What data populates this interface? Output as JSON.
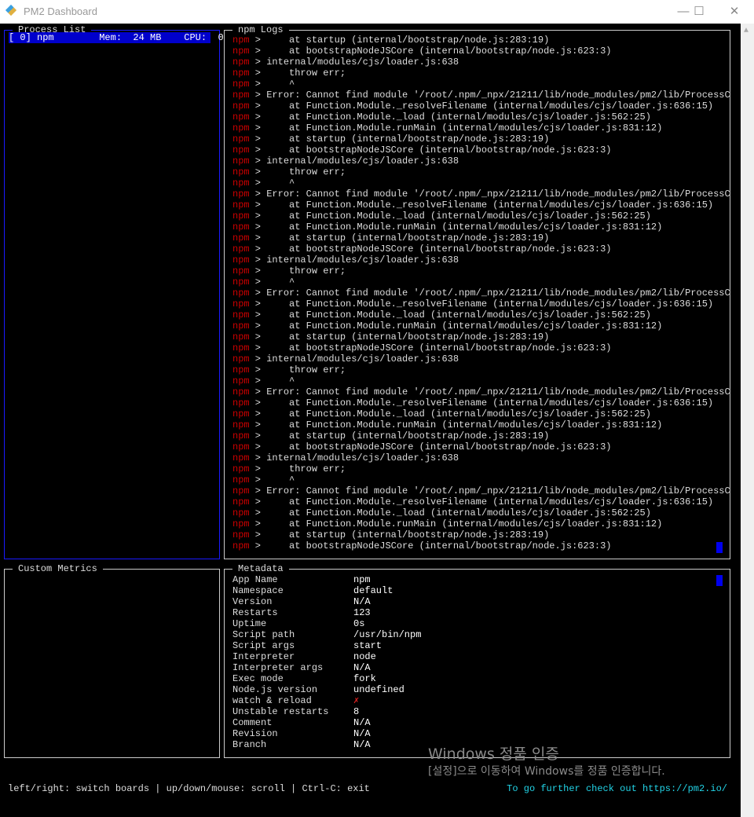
{
  "window": {
    "title": "PM2 Dashboard",
    "minimize": "—",
    "maximize": "☐",
    "close": "✕"
  },
  "process_list": {
    "title": "Process List",
    "items": [
      {
        "label": "[ 0] npm        Mem:  24 MB    CPU:  0"
      }
    ]
  },
  "logs": {
    "title": "npm Logs",
    "prefix": "npm",
    "lines": [
      "     at startup (internal/bootstrap/node.js:283:19)",
      "     at bootstrapNodeJSCore (internal/bootstrap/node.js:623:3)",
      " internal/modules/cjs/loader.js:638",
      "     throw err;",
      "     ^",
      " Error: Cannot find module '/root/.npm/_npx/21211/lib/node_modules/pm2/lib/ProcessC",
      "     at Function.Module._resolveFilename (internal/modules/cjs/loader.js:636:15)",
      "     at Function.Module._load (internal/modules/cjs/loader.js:562:25)",
      "     at Function.Module.runMain (internal/modules/cjs/loader.js:831:12)",
      "     at startup (internal/bootstrap/node.js:283:19)",
      "     at bootstrapNodeJSCore (internal/bootstrap/node.js:623:3)",
      " internal/modules/cjs/loader.js:638",
      "     throw err;",
      "     ^",
      " Error: Cannot find module '/root/.npm/_npx/21211/lib/node_modules/pm2/lib/ProcessC",
      "     at Function.Module._resolveFilename (internal/modules/cjs/loader.js:636:15)",
      "     at Function.Module._load (internal/modules/cjs/loader.js:562:25)",
      "     at Function.Module.runMain (internal/modules/cjs/loader.js:831:12)",
      "     at startup (internal/bootstrap/node.js:283:19)",
      "     at bootstrapNodeJSCore (internal/bootstrap/node.js:623:3)",
      " internal/modules/cjs/loader.js:638",
      "     throw err;",
      "     ^",
      " Error: Cannot find module '/root/.npm/_npx/21211/lib/node_modules/pm2/lib/ProcessC",
      "     at Function.Module._resolveFilename (internal/modules/cjs/loader.js:636:15)",
      "     at Function.Module._load (internal/modules/cjs/loader.js:562:25)",
      "     at Function.Module.runMain (internal/modules/cjs/loader.js:831:12)",
      "     at startup (internal/bootstrap/node.js:283:19)",
      "     at bootstrapNodeJSCore (internal/bootstrap/node.js:623:3)",
      " internal/modules/cjs/loader.js:638",
      "     throw err;",
      "     ^",
      " Error: Cannot find module '/root/.npm/_npx/21211/lib/node_modules/pm2/lib/ProcessC",
      "     at Function.Module._resolveFilename (internal/modules/cjs/loader.js:636:15)",
      "     at Function.Module._load (internal/modules/cjs/loader.js:562:25)",
      "     at Function.Module.runMain (internal/modules/cjs/loader.js:831:12)",
      "     at startup (internal/bootstrap/node.js:283:19)",
      "     at bootstrapNodeJSCore (internal/bootstrap/node.js:623:3)",
      " internal/modules/cjs/loader.js:638",
      "     throw err;",
      "     ^",
      " Error: Cannot find module '/root/.npm/_npx/21211/lib/node_modules/pm2/lib/ProcessC",
      "     at Function.Module._resolveFilename (internal/modules/cjs/loader.js:636:15)",
      "     at Function.Module._load (internal/modules/cjs/loader.js:562:25)",
      "     at Function.Module.runMain (internal/modules/cjs/loader.js:831:12)",
      "     at startup (internal/bootstrap/node.js:283:19)",
      "     at bootstrapNodeJSCore (internal/bootstrap/node.js:623:3)"
    ]
  },
  "custom_metrics": {
    "title": "Custom Metrics"
  },
  "metadata": {
    "title": "Metadata",
    "rows": [
      {
        "key": "App Name",
        "value": "npm"
      },
      {
        "key": "Namespace",
        "value": "default"
      },
      {
        "key": "Version",
        "value": "N/A"
      },
      {
        "key": "Restarts",
        "value": "123"
      },
      {
        "key": "Uptime",
        "value": "0s"
      },
      {
        "key": "Script path",
        "value": "/usr/bin/npm"
      },
      {
        "key": "Script args",
        "value": "start"
      },
      {
        "key": "Interpreter",
        "value": "node"
      },
      {
        "key": "Interpreter args",
        "value": "N/A"
      },
      {
        "key": "Exec mode",
        "value": "fork"
      },
      {
        "key": "Node.js version",
        "value": "undefined"
      },
      {
        "key": "watch & reload",
        "value": "✗"
      },
      {
        "key": "Unstable restarts",
        "value": "8"
      },
      {
        "key": "Comment",
        "value": "N/A"
      },
      {
        "key": "Revision",
        "value": "N/A"
      },
      {
        "key": "Branch",
        "value": "N/A"
      }
    ]
  },
  "footer": {
    "help": "left/right: switch boards | up/down/mouse: scroll | Ctrl-C: exit",
    "link": "To go further check out https://pm2.io/"
  },
  "watermark": {
    "line1": "Windows 정품 인증",
    "line2": "[설정]으로 이동하여 Windows를 정품 인증합니다."
  }
}
